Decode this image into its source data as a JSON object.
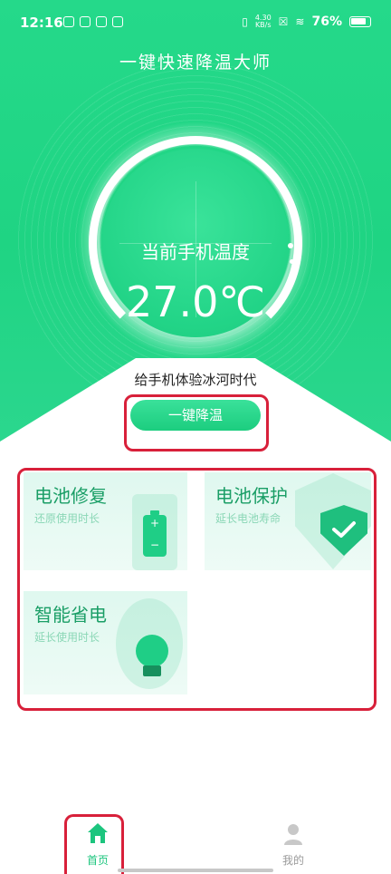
{
  "status_bar": {
    "time": "12:16",
    "net_speed_value": "4.30",
    "net_speed_unit": "KB/s",
    "battery_percent": "76%"
  },
  "app": {
    "title": "一键快速降温大师"
  },
  "gauge": {
    "label": "当前手机温度",
    "temperature": "27.0℃"
  },
  "slogan": "给手机体验冰河时代",
  "cool_button": {
    "label": "一键降温"
  },
  "cards": [
    {
      "title": "电池修复",
      "subtitle": "还原使用时长"
    },
    {
      "title": "电池保护",
      "subtitle": "延长电池寿命"
    },
    {
      "title": "智能省电",
      "subtitle": "延长使用时长"
    }
  ],
  "battery_icon_signs": {
    "plus": "+",
    "minus": "−"
  },
  "nav": {
    "home": "首页",
    "me": "我的"
  },
  "colors": {
    "brand_green": "#1fd483",
    "highlight_red": "#d8203a",
    "card_title": "#1a9e66"
  }
}
